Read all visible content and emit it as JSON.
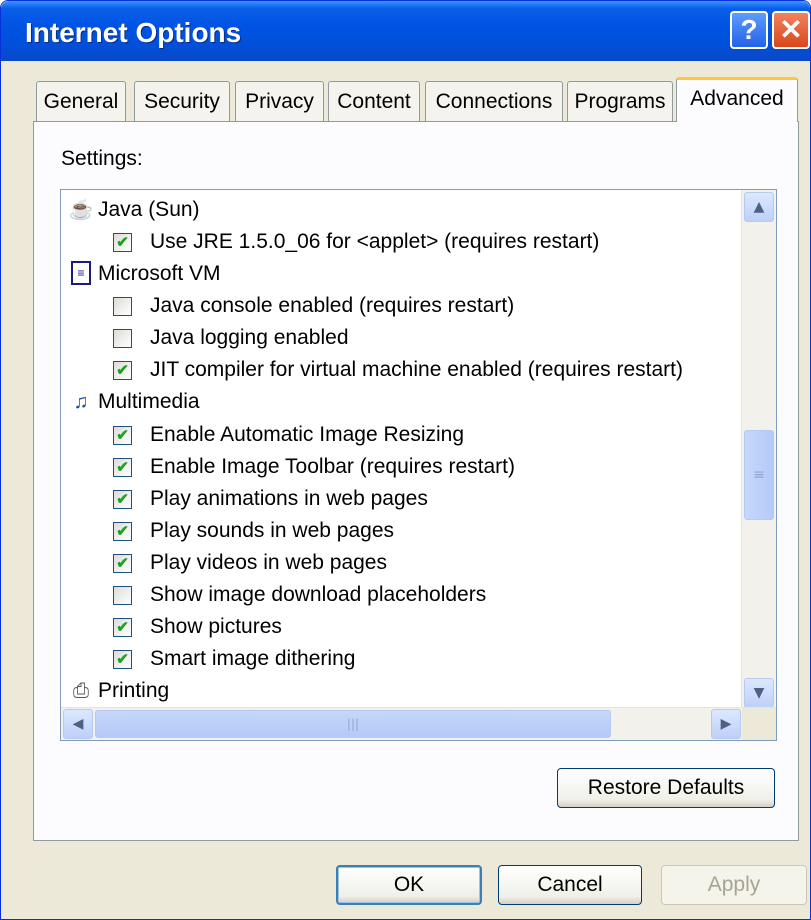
{
  "window": {
    "title": "Internet Options"
  },
  "titlebar": {
    "help_glyph": "?",
    "close_glyph": "✕"
  },
  "tabs": [
    {
      "label": "General",
      "active": false
    },
    {
      "label": "Security",
      "active": false
    },
    {
      "label": "Privacy",
      "active": false
    },
    {
      "label": "Content",
      "active": false
    },
    {
      "label": "Connections",
      "active": false
    },
    {
      "label": "Programs",
      "active": false
    },
    {
      "label": "Advanced",
      "active": true
    }
  ],
  "settings_label": "Settings:",
  "settings_items": [
    {
      "type": "category",
      "icon": "java-cup-icon",
      "label": "Java (Sun)"
    },
    {
      "type": "option",
      "checked": true,
      "label": "Use JRE 1.5.0_06 for <applet> (requires restart)"
    },
    {
      "type": "category",
      "icon": "document-icon",
      "label": "Microsoft VM"
    },
    {
      "type": "option",
      "checked": false,
      "label": "Java console enabled (requires restart)"
    },
    {
      "type": "option",
      "checked": false,
      "label": "Java logging enabled"
    },
    {
      "type": "option",
      "checked": true,
      "label": "JIT compiler for virtual machine enabled (requires restart)"
    },
    {
      "type": "category",
      "icon": "multimedia-icon",
      "label": "Multimedia"
    },
    {
      "type": "option",
      "checked": true,
      "label": "Enable Automatic Image Resizing"
    },
    {
      "type": "option",
      "checked": true,
      "label": "Enable Image Toolbar (requires restart)"
    },
    {
      "type": "option",
      "checked": true,
      "label": "Play animations in web pages"
    },
    {
      "type": "option",
      "checked": true,
      "label": "Play sounds in web pages"
    },
    {
      "type": "option",
      "checked": true,
      "label": "Play videos in web pages"
    },
    {
      "type": "option",
      "checked": false,
      "label": "Show image download placeholders"
    },
    {
      "type": "option",
      "checked": true,
      "label": "Show pictures"
    },
    {
      "type": "option",
      "checked": true,
      "label": "Smart image dithering"
    },
    {
      "type": "category",
      "icon": "printer-icon",
      "label": "Printing"
    }
  ],
  "buttons": {
    "restore_defaults": "Restore Defaults",
    "ok": "OK",
    "cancel": "Cancel",
    "apply": "Apply"
  },
  "colors": {
    "titlebar": "#0054E3",
    "dialog_bg": "#ECE9D8",
    "active_tab_accent": "#FFC83C",
    "check": "#21A121"
  }
}
